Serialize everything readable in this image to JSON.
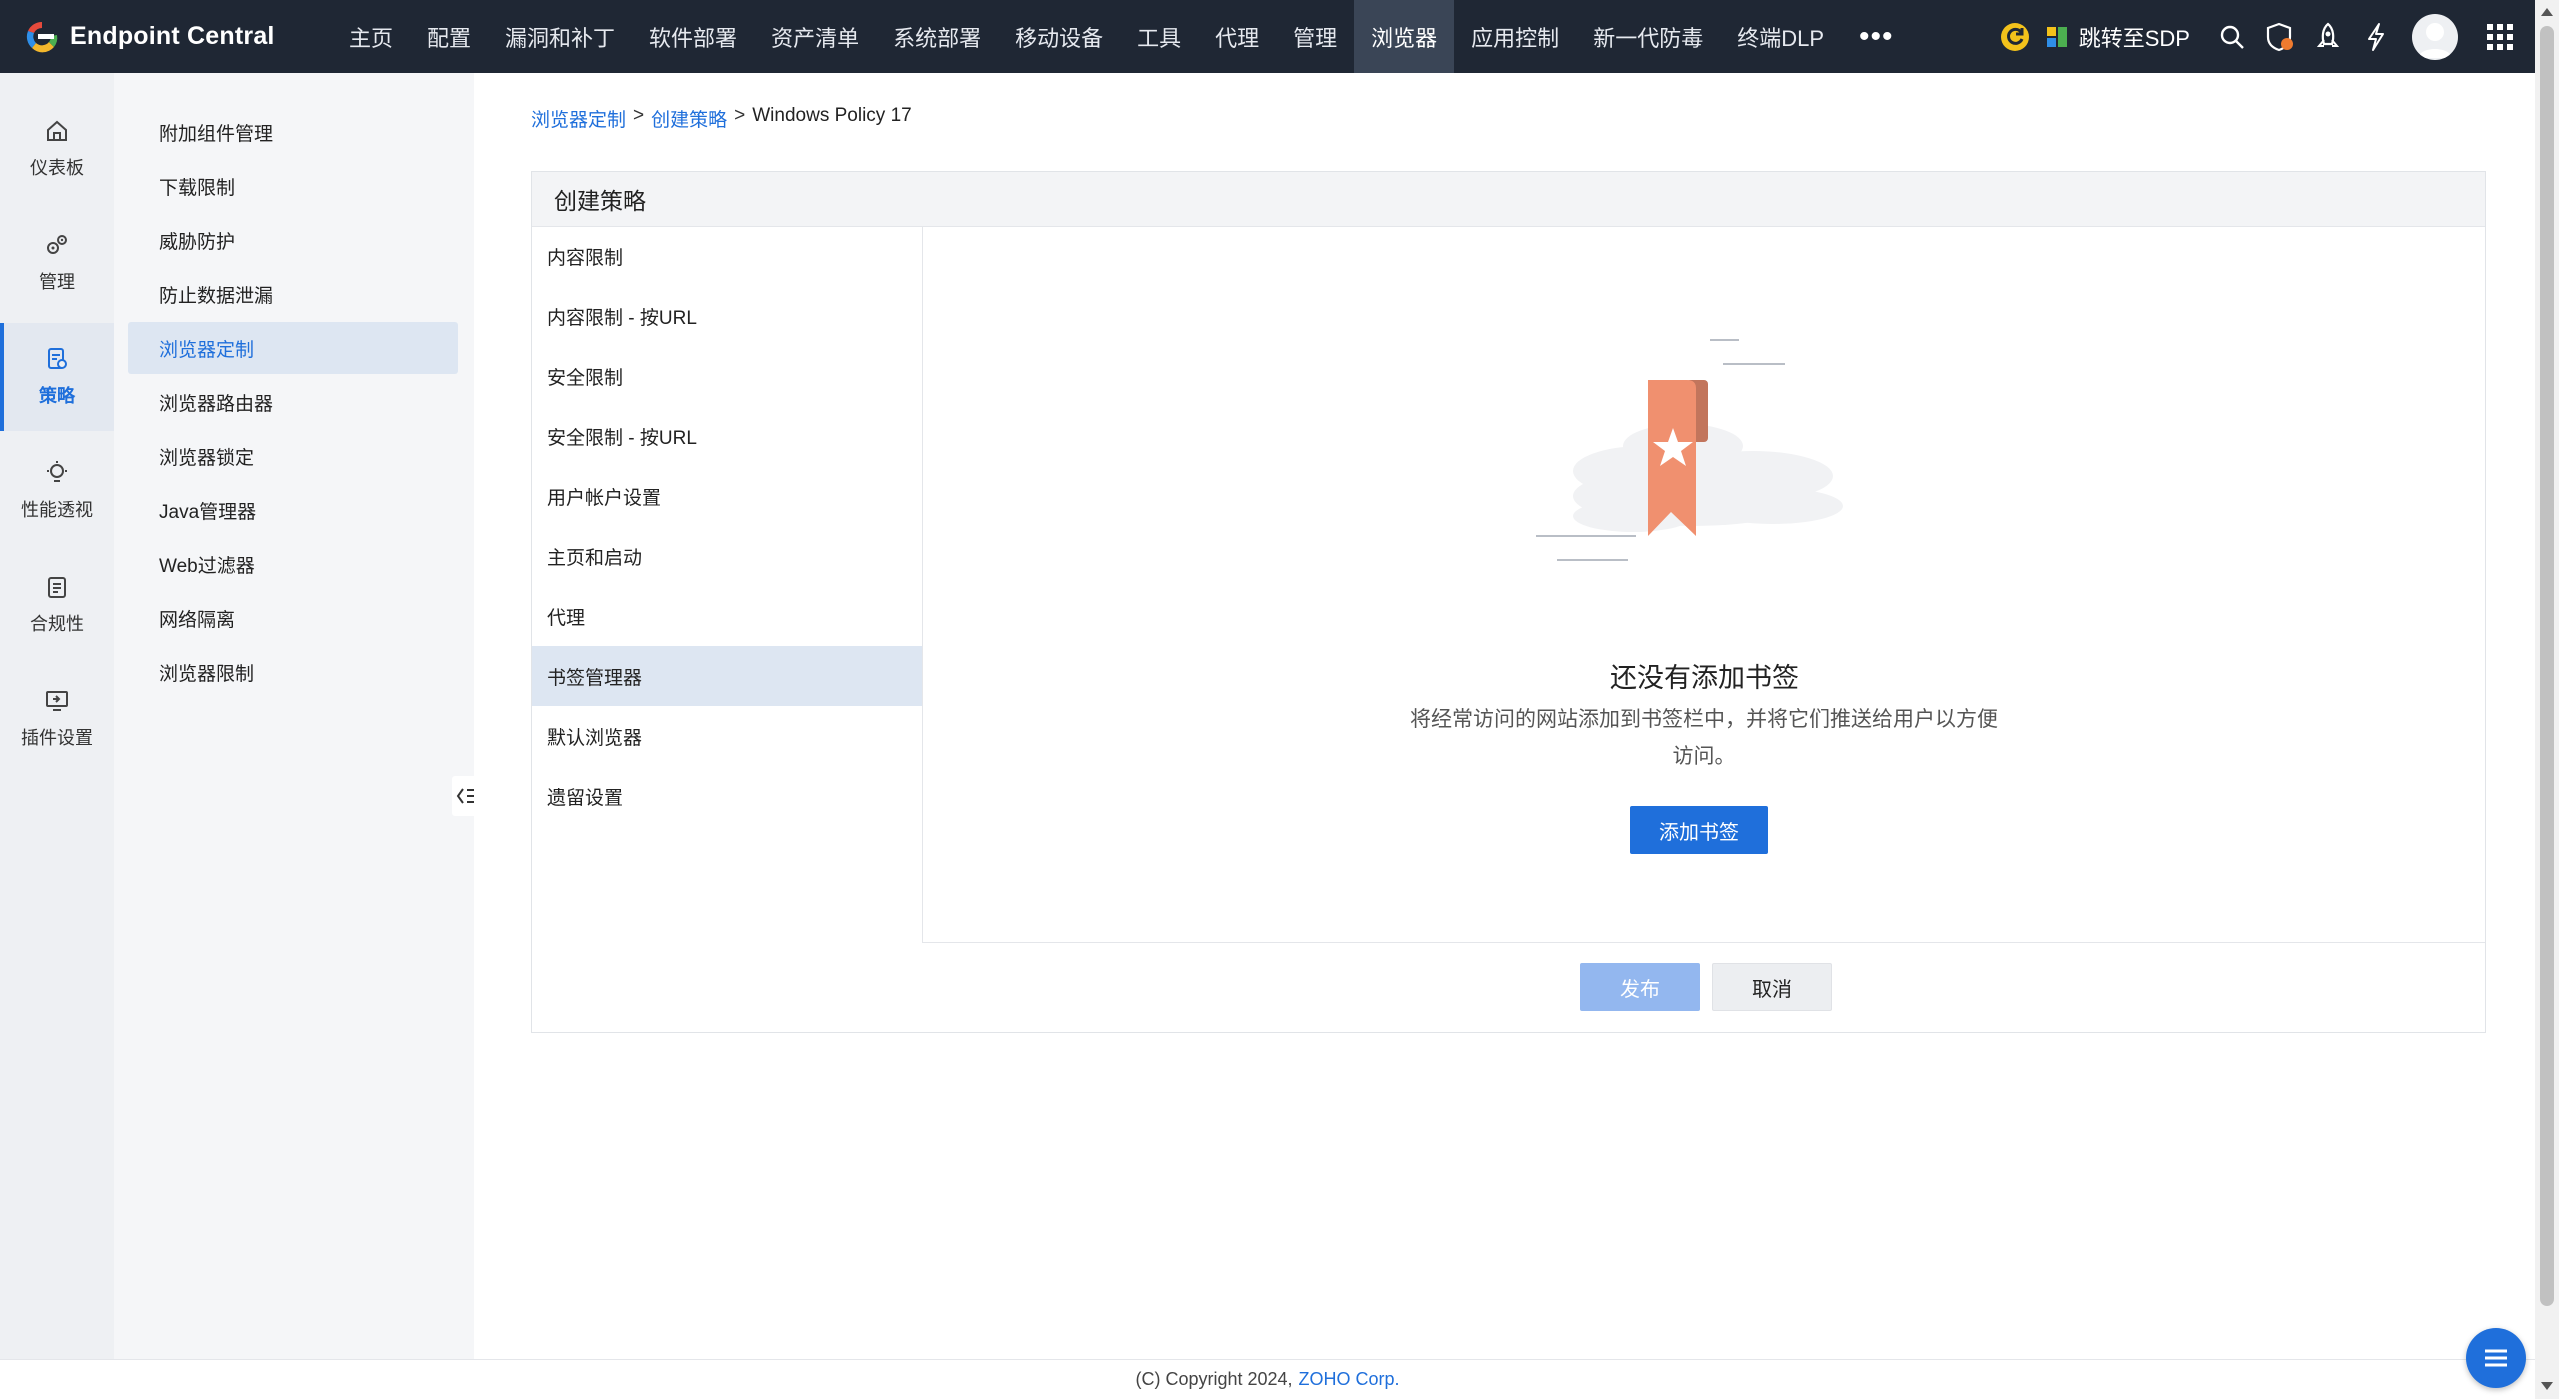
{
  "app": {
    "brand": "Endpoint Central"
  },
  "topnav": {
    "items": [
      "主页",
      "配置",
      "漏洞和补丁",
      "软件部署",
      "资产清单",
      "系统部署",
      "移动设备",
      "工具",
      "代理",
      "管理",
      "浏览器",
      "应用控制",
      "新一代防毒",
      "终端DLP"
    ],
    "active": "浏览器",
    "more": "•••",
    "sdp_link": "跳转至SDP"
  },
  "rail": {
    "items": [
      {
        "label": "仪表板",
        "icon": "home-icon"
      },
      {
        "label": "管理",
        "icon": "gears-icon"
      },
      {
        "label": "策略",
        "icon": "policy-icon"
      },
      {
        "label": "性能透视",
        "icon": "bulb-icon"
      },
      {
        "label": "合规性",
        "icon": "compliance-icon"
      },
      {
        "label": "插件设置",
        "icon": "plugin-icon"
      }
    ],
    "active": "策略"
  },
  "submenu": {
    "items": [
      "附加组件管理",
      "下载限制",
      "威胁防护",
      "防止数据泄漏",
      "浏览器定制",
      "浏览器路由器",
      "浏览器锁定",
      "Java管理器",
      "Web过滤器",
      "网络隔离",
      "浏览器限制"
    ],
    "active": "浏览器定制"
  },
  "breadcrumb": {
    "items": [
      "浏览器定制",
      "创建策略"
    ],
    "separator": ">",
    "current": "Windows Policy 17"
  },
  "panel": {
    "title": "创建策略",
    "nav": [
      "内容限制",
      "内容限制 - 按URL",
      "安全限制",
      "安全限制 - 按URL",
      "用户帐户设置",
      "主页和启动",
      "代理",
      "书签管理器",
      "默认浏览器",
      "遗留设置"
    ],
    "active_nav": "书签管理器",
    "empty": {
      "title": "还没有添加书签",
      "description": "将经常访问的网站添加到书签栏中，并将它们推送给用户以方便访问。",
      "button": "添加书签"
    },
    "actions": {
      "publish": "发布",
      "cancel": "取消"
    }
  },
  "footer": {
    "copyright": "(C) Copyright 2024,",
    "company": "ZOHO Corp."
  },
  "colors": {
    "topbar": "#1f2734",
    "accent": "#1f6fdb",
    "active_bg": "#dde6f2",
    "bookmark": "#f0906f"
  }
}
